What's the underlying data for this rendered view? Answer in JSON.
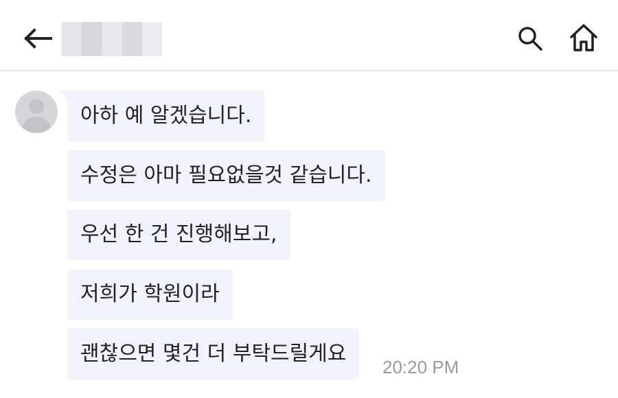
{
  "header": {
    "contact_name": "■■■■",
    "back_icon": "arrow-left-icon",
    "search_icon": "search-icon",
    "home_icon": "home-icon"
  },
  "messages": [
    {
      "text": "아하 예 알겠습니다."
    },
    {
      "text": "수정은 아마 필요없을것 같습니다."
    },
    {
      "text": "우선 한 건 진행해보고,"
    },
    {
      "text": "저희가 학원이라"
    },
    {
      "text": "괜찮으면 몇건 더 부탁드릴게요"
    }
  ],
  "timestamp": "20:20 PM",
  "colors": {
    "bubble_bg": "#f1f2fb",
    "divider": "#e6e6ea",
    "timestamp": "#9a9a9a"
  }
}
